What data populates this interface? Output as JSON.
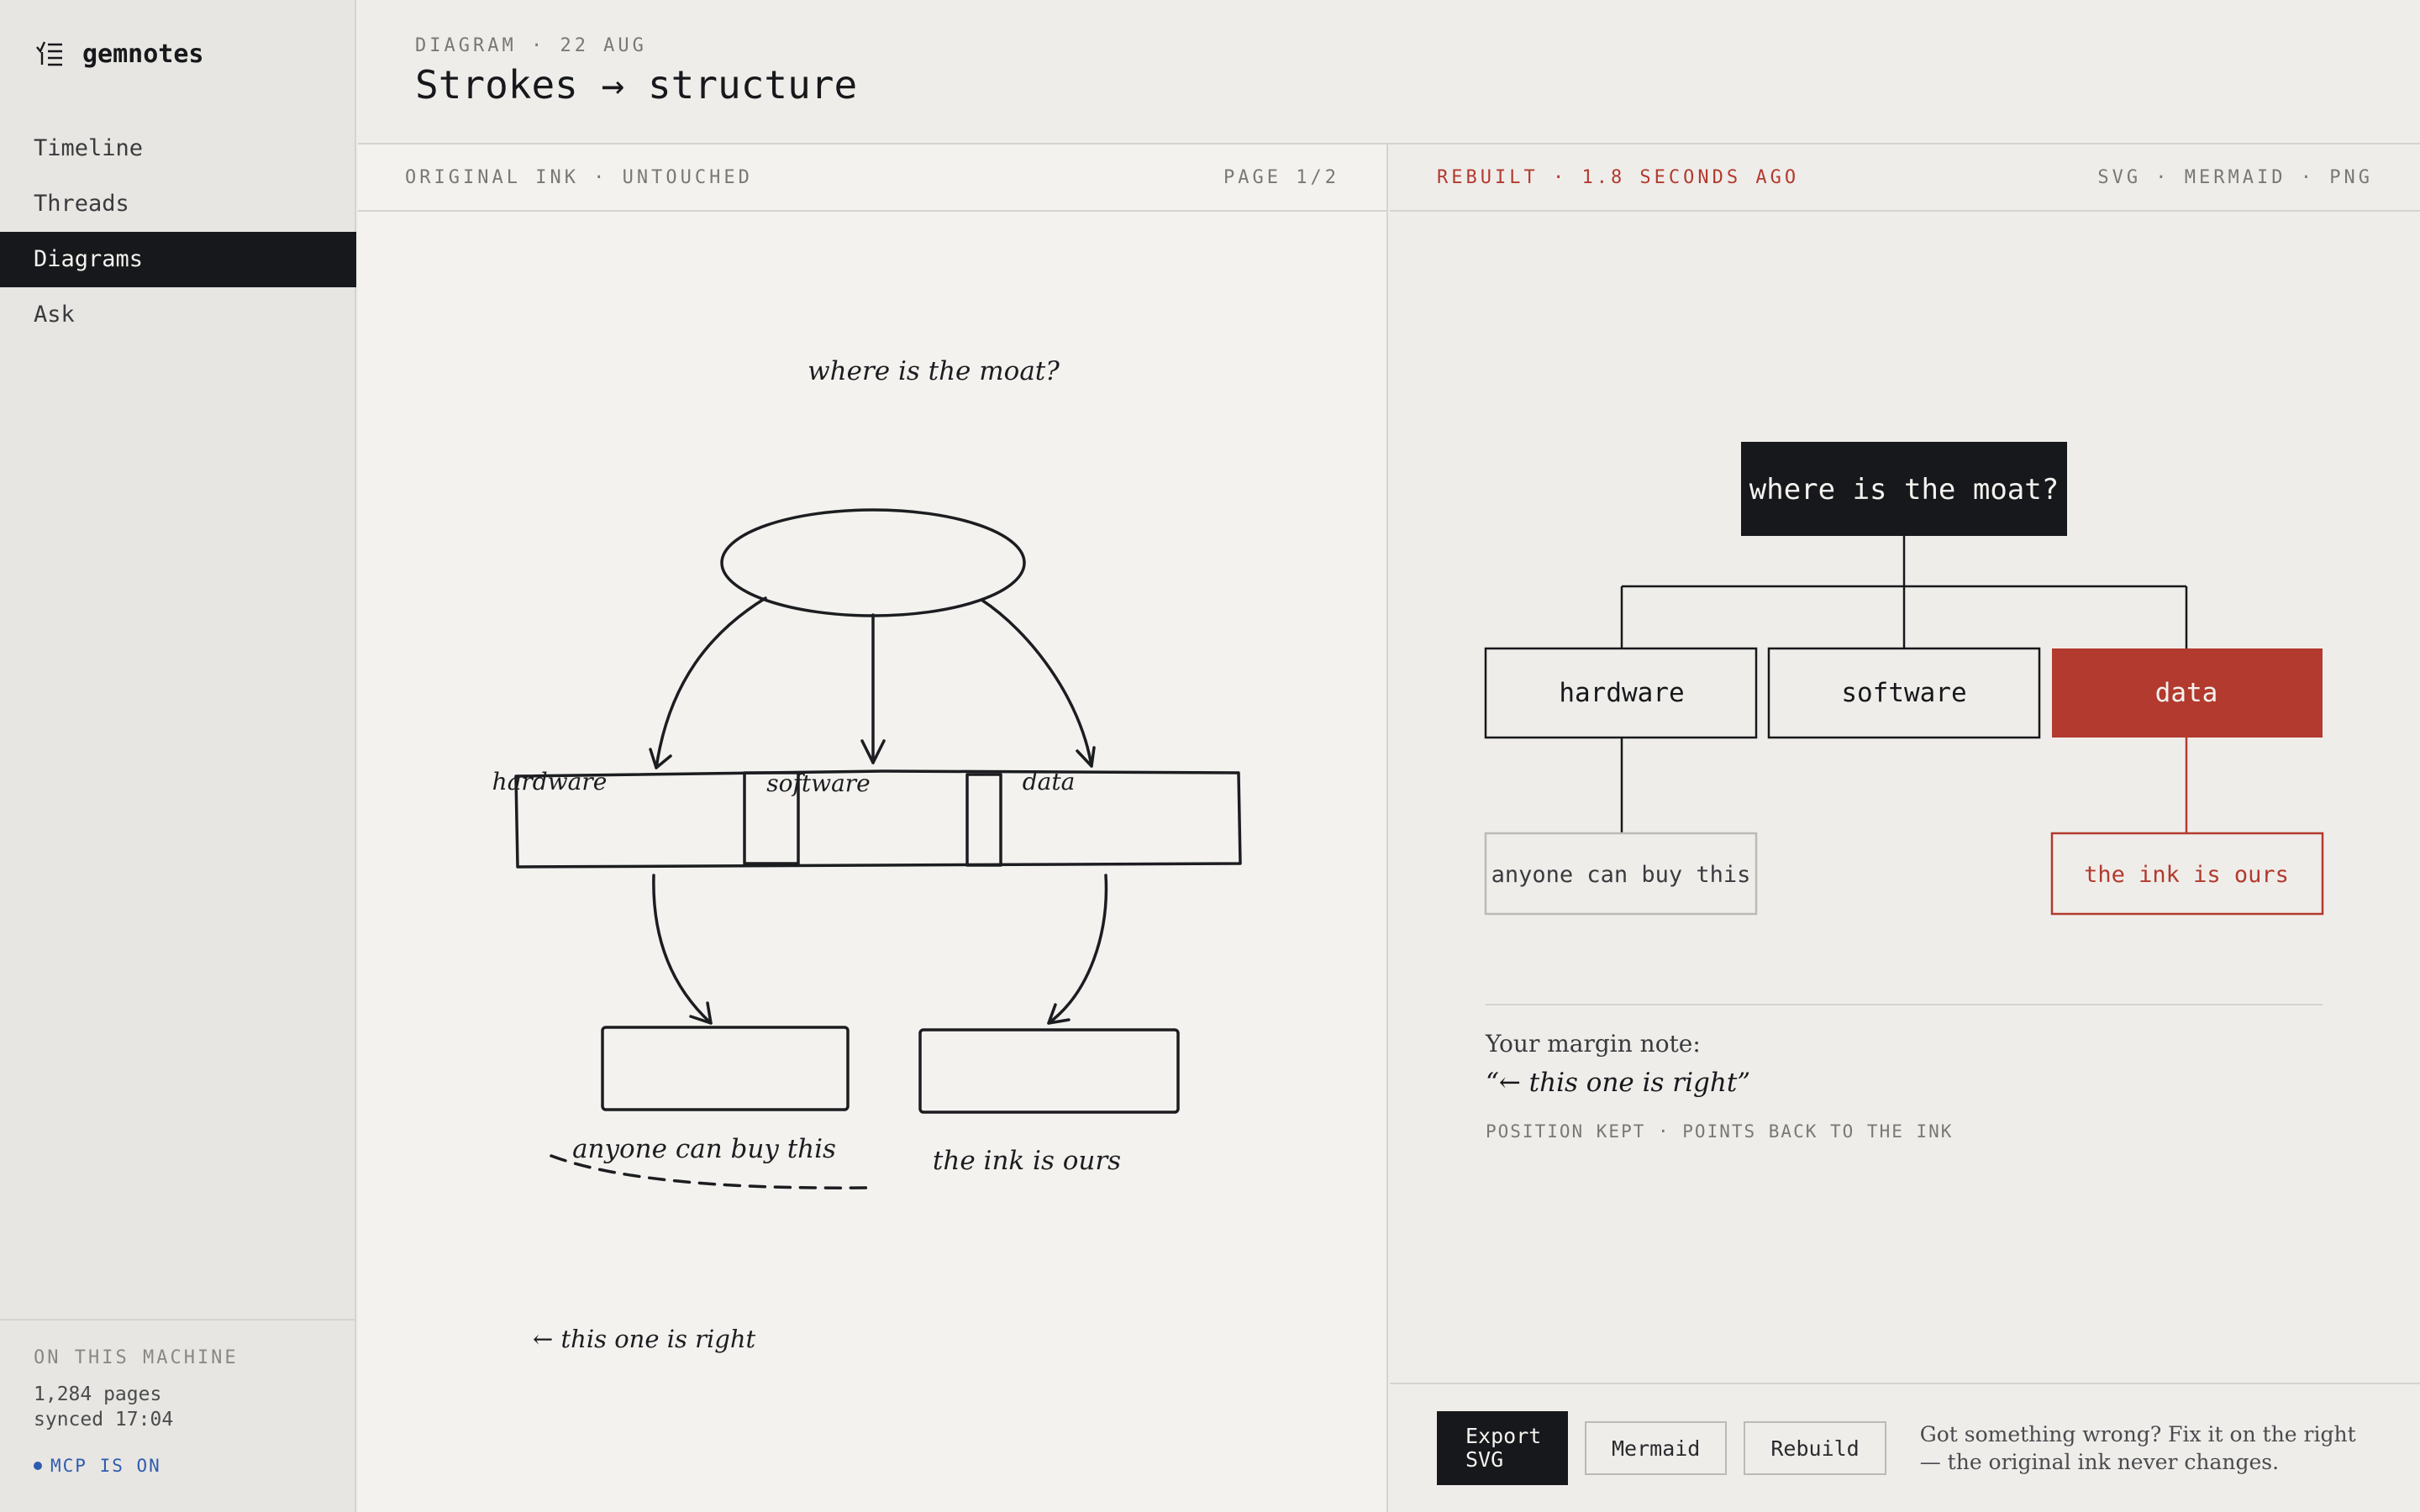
{
  "app": {
    "name": "gemnotes"
  },
  "nav": {
    "items": [
      "Timeline",
      "Threads",
      "Diagrams",
      "Ask"
    ],
    "active": "Diagrams"
  },
  "sidebar_footer": {
    "caption": "ON THIS MACHINE",
    "pages": "1,284 pages",
    "synced": "synced 17:04",
    "mcp": "MCP IS ON"
  },
  "header": {
    "kicker": "DIAGRAM · 22 AUG",
    "title": "Strokes → structure"
  },
  "original": {
    "label": "ORIGINAL INK · UNTOUCHED",
    "page": "PAGE 1/2",
    "ink_title": "where is the moat?",
    "branches": [
      "hardware",
      "software",
      "data"
    ],
    "notes": [
      "anyone can buy this",
      "the ink is ours"
    ],
    "margin": "← this one is right"
  },
  "rebuilt": {
    "label": "REBUILT · 1.8 SECONDS AGO",
    "formats": "SVG · MERMAID · PNG",
    "root": "where is the moat?",
    "children": [
      "hardware",
      "software",
      "data"
    ],
    "leaves": [
      "anyone can buy this",
      "the ink is ours"
    ],
    "highlight_color": "#b23a2e",
    "margin_note_label": "Your margin note:",
    "margin_note_quote": "“← this one is right”",
    "margin_note_caption": "POSITION KEPT · POINTS BACK TO THE INK"
  },
  "actions": {
    "export": "Export SVG",
    "mermaid": "Mermaid",
    "rebuild": "Rebuild",
    "help": "Got something wrong? Fix it on the right — the original ink never changes."
  }
}
